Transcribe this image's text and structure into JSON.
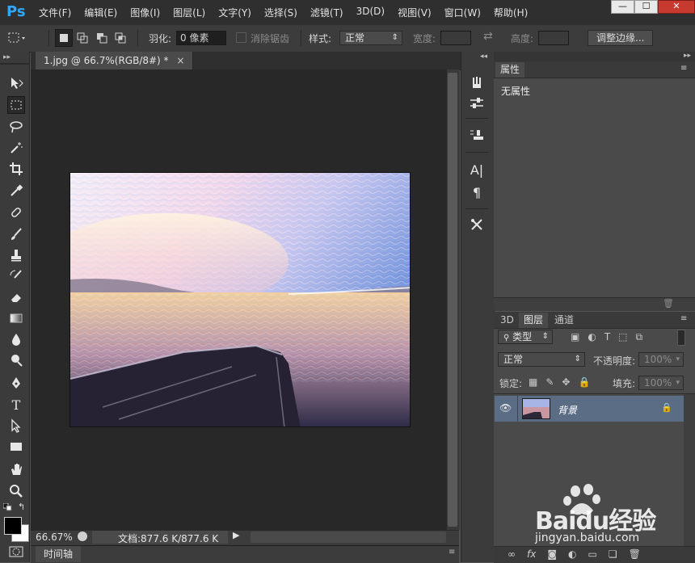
{
  "app": {
    "logo_text": "Ps"
  },
  "menubar": {
    "items": [
      "文件(F)",
      "编辑(E)",
      "图像(I)",
      "图层(L)",
      "文字(Y)",
      "选择(S)",
      "滤镜(T)",
      "3D(D)",
      "视图(V)",
      "窗口(W)",
      "帮助(H)"
    ]
  },
  "window_controls": {
    "minimize": "—",
    "maximize": "☐",
    "close": "✕"
  },
  "options": {
    "feather_label": "羽化:",
    "feather_value": "0 像素",
    "antialias_label": "消除锯齿",
    "style_label": "样式:",
    "style_value": "正常",
    "width_label": "宽度:",
    "height_label": "高度:",
    "refine_edge_button": "调整边缘..."
  },
  "document": {
    "tab_title": "1.jpg @ 66.7%(RGB/8#) *",
    "tab_close": "×"
  },
  "status": {
    "zoom": "66.67%",
    "doc_info": "文档:877.6 K/877.6 K"
  },
  "timeline": {
    "tab": "时间轴"
  },
  "properties_panel": {
    "tab": "属性",
    "empty_text": "无属性"
  },
  "layers_panel": {
    "tabs": [
      "3D",
      "图层",
      "通道"
    ],
    "active_tab": "图层",
    "filter_kind": "类型",
    "blend_mode": "正常",
    "opacity_label": "不透明度:",
    "opacity_value": "100%",
    "lock_label": "锁定:",
    "fill_label": "填充:",
    "fill_value": "100%",
    "layers": [
      {
        "name": "背景",
        "visible": true,
        "locked": true
      }
    ]
  },
  "watermark": {
    "brand_text": "Baidu经验",
    "url_text": "jingyan.baidu.com"
  },
  "colors": {
    "menubar_bg": "#2f2f2f",
    "panel_bg": "#4a4a4a",
    "canvas_bg": "#282828",
    "selected_layer": "#5b6c85",
    "ps_blue": "#31a8ff",
    "close_red": "#c63a2f"
  }
}
